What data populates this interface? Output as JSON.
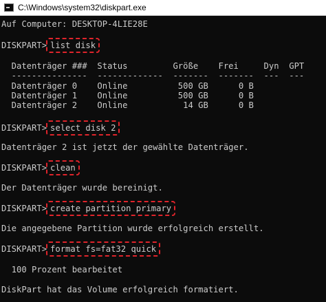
{
  "window": {
    "title": "C:\\Windows\\system32\\diskpart.exe",
    "icon": "console-icon"
  },
  "console": {
    "prompt": "DISKPART>",
    "computer_line": "Auf Computer: DESKTOP-4LIE28E",
    "commands": [
      "list disk",
      "select disk 2",
      "clean",
      "create partition primary",
      "format fs=fat32 quick"
    ],
    "disk_table": {
      "header": "  Datenträger ###  Status         Größe    Frei     Dyn  GPT",
      "separator": "  ---------------  -------------  -------  -------  ---  ---",
      "rows": [
        "  Datenträger 0    Online          500 GB      0 B",
        "  Datenträger 1    Online          500 GB      0 B",
        "  Datenträger 2    Online           14 GB      0 B"
      ]
    },
    "messages": {
      "selected": "Datenträger 2 ist jetzt der gewählte Datenträger.",
      "cleaned": "Der Datenträger wurde bereinigt.",
      "partition_created": "Die angegebene Partition wurde erfolgreich erstellt.",
      "progress": "  100 Prozent bearbeitet",
      "formatted": "DiskPart hat das Volume erfolgreich formatiert."
    },
    "highlight_color": "#e0242b",
    "text_color": "#cccccc",
    "background_color": "#0c0c0c"
  }
}
